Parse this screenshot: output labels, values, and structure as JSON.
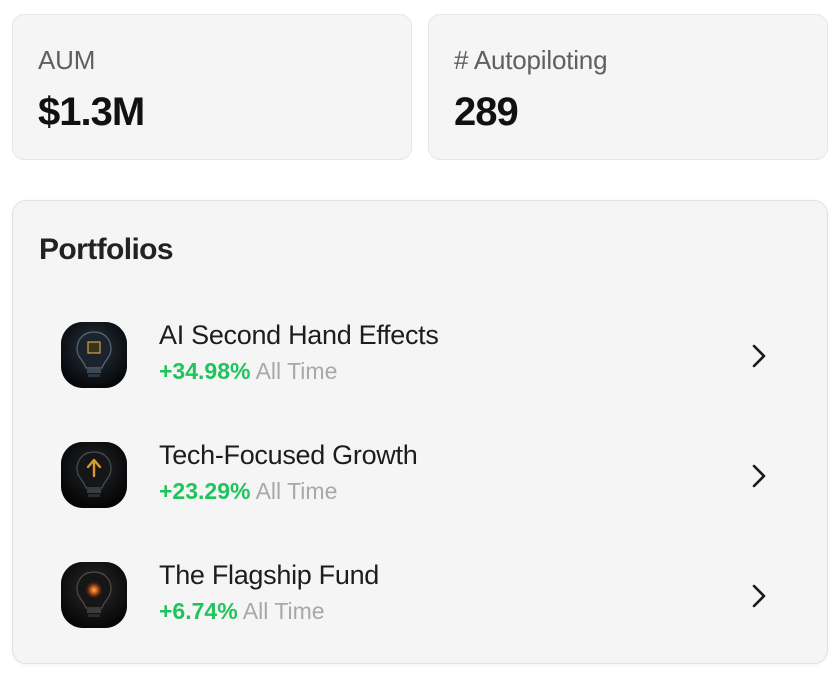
{
  "stats": {
    "aum": {
      "label": "AUM",
      "value": "$1.3M"
    },
    "autopiloting": {
      "label": "# Autopiloting",
      "value": "289"
    }
  },
  "portfolios": {
    "title": "Portfolios",
    "items": [
      {
        "name": "AI Second Hand Effects",
        "change": "+34.98%",
        "period": "All Time",
        "icon": "lightbulb-chip-icon"
      },
      {
        "name": "Tech-Focused Growth",
        "change": "+23.29%",
        "period": "All Time",
        "icon": "lightbulb-arrow-icon"
      },
      {
        "name": "The Flagship Fund",
        "change": "+6.74%",
        "period": "All Time",
        "icon": "lightbulb-glow-icon"
      }
    ]
  },
  "colors": {
    "positive": "#1fc45c",
    "muted": "#a8a8a8",
    "card_bg": "#f5f5f5"
  }
}
